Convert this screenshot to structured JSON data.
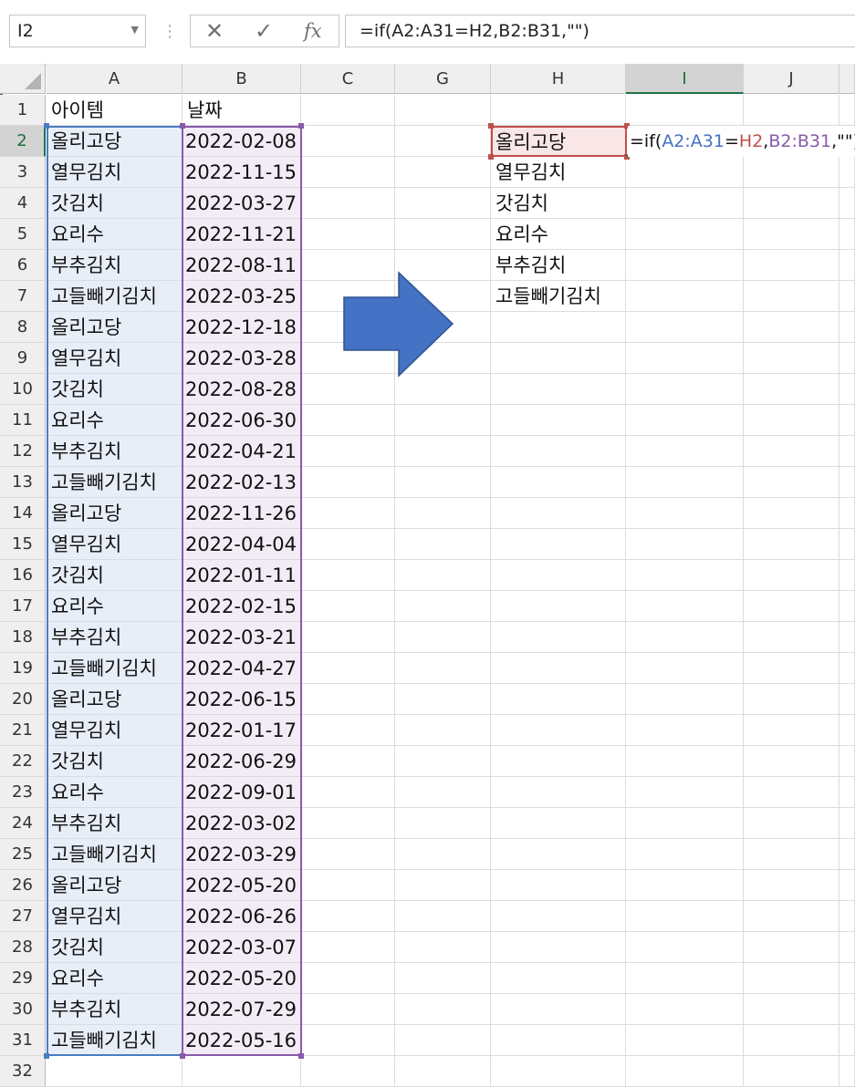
{
  "name_box": {
    "value": "I2"
  },
  "formula_bar": {
    "cancel_icon": "✕",
    "enter_icon": "✓",
    "fx_label": "fx",
    "formula": "=if(A2:A31=H2,B2:B31,\"\")"
  },
  "columns": [
    "A",
    "B",
    "C",
    "G",
    "H",
    "I",
    "J"
  ],
  "selected_column": "I",
  "selected_row": 2,
  "headers": {
    "A1": "아이템",
    "B1": "날짜"
  },
  "rows": [
    {
      "n": 1
    },
    {
      "n": 2,
      "item": "올리고당",
      "date": "2022-02-08"
    },
    {
      "n": 3,
      "item": "열무김치",
      "date": "2022-11-15"
    },
    {
      "n": 4,
      "item": "갓김치",
      "date": "2022-03-27"
    },
    {
      "n": 5,
      "item": "요리수",
      "date": "2022-11-21"
    },
    {
      "n": 6,
      "item": "부추김치",
      "date": "2022-08-11"
    },
    {
      "n": 7,
      "item": "고들빼기김치",
      "date": "2022-03-25"
    },
    {
      "n": 8,
      "item": "올리고당",
      "date": "2022-12-18"
    },
    {
      "n": 9,
      "item": "열무김치",
      "date": "2022-03-28"
    },
    {
      "n": 10,
      "item": "갓김치",
      "date": "2022-08-28"
    },
    {
      "n": 11,
      "item": "요리수",
      "date": "2022-06-30"
    },
    {
      "n": 12,
      "item": "부추김치",
      "date": "2022-04-21"
    },
    {
      "n": 13,
      "item": "고들빼기김치",
      "date": "2022-02-13"
    },
    {
      "n": 14,
      "item": "올리고당",
      "date": "2022-11-26"
    },
    {
      "n": 15,
      "item": "열무김치",
      "date": "2022-04-04"
    },
    {
      "n": 16,
      "item": "갓김치",
      "date": "2022-01-11"
    },
    {
      "n": 17,
      "item": "요리수",
      "date": "2022-02-15"
    },
    {
      "n": 18,
      "item": "부추김치",
      "date": "2022-03-21"
    },
    {
      "n": 19,
      "item": "고들빼기김치",
      "date": "2022-04-27"
    },
    {
      "n": 20,
      "item": "올리고당",
      "date": "2022-06-15"
    },
    {
      "n": 21,
      "item": "열무김치",
      "date": "2022-01-17"
    },
    {
      "n": 22,
      "item": "갓김치",
      "date": "2022-06-29"
    },
    {
      "n": 23,
      "item": "요리수",
      "date": "2022-09-01"
    },
    {
      "n": 24,
      "item": "부추김치",
      "date": "2022-03-02"
    },
    {
      "n": 25,
      "item": "고들빼기김치",
      "date": "2022-03-29"
    },
    {
      "n": 26,
      "item": "올리고당",
      "date": "2022-05-20"
    },
    {
      "n": 27,
      "item": "열무김치",
      "date": "2022-06-26"
    },
    {
      "n": 28,
      "item": "갓김치",
      "date": "2022-03-07"
    },
    {
      "n": 29,
      "item": "요리수",
      "date": "2022-05-20"
    },
    {
      "n": 30,
      "item": "부추김치",
      "date": "2022-07-29"
    },
    {
      "n": 31,
      "item": "고들빼기김치",
      "date": "2022-05-16"
    },
    {
      "n": 32
    }
  ],
  "h_column": [
    "올리고당",
    "열무김치",
    "갓김치",
    "요리수",
    "부추김치",
    "고들빼기김치"
  ],
  "in_cell_editor": {
    "prefix": "=if(",
    "range_a": "A2:A31",
    "eq": "=",
    "ref_h": "H2",
    "comma1": ",",
    "range_b": "B2:B31",
    "suffix": ",\"\")"
  },
  "arrow": {
    "direction": "right",
    "fill": "#4472c4",
    "stroke": "#2f528f"
  },
  "colors": {
    "excel_green": "#217346",
    "range_a": "#4472c4",
    "range_b": "#8a5aab",
    "ref_h": "#c0504d"
  }
}
